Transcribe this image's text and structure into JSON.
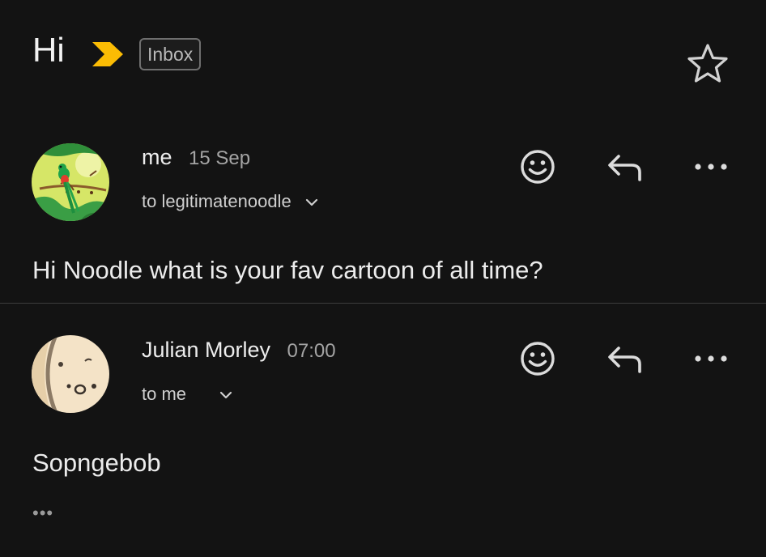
{
  "thread": {
    "subject": "Hi",
    "label": "Inbox",
    "importance_color": "#fbbc04"
  },
  "messages": [
    {
      "sender": "me",
      "date": "15 Sep",
      "recipients": "to legitimatenoodle",
      "body": "Hi Noodle what is your fav cartoon of all time?",
      "avatar": "quetzal-bird-avatar"
    },
    {
      "sender": "Julian Morley",
      "date": "07:00",
      "recipients": "to me",
      "body": "Sopngebob",
      "trimmed_content": "•••",
      "avatar": "cartoon-face-avatar"
    }
  ],
  "icons": {
    "star": "star-outline-icon",
    "emoji": "smiley-icon",
    "reply": "reply-icon",
    "more": "more-horizontal-icon"
  },
  "colors": {
    "background": "#131313",
    "text": "#e8e8e8",
    "secondary_text": "#a4a4a4"
  }
}
